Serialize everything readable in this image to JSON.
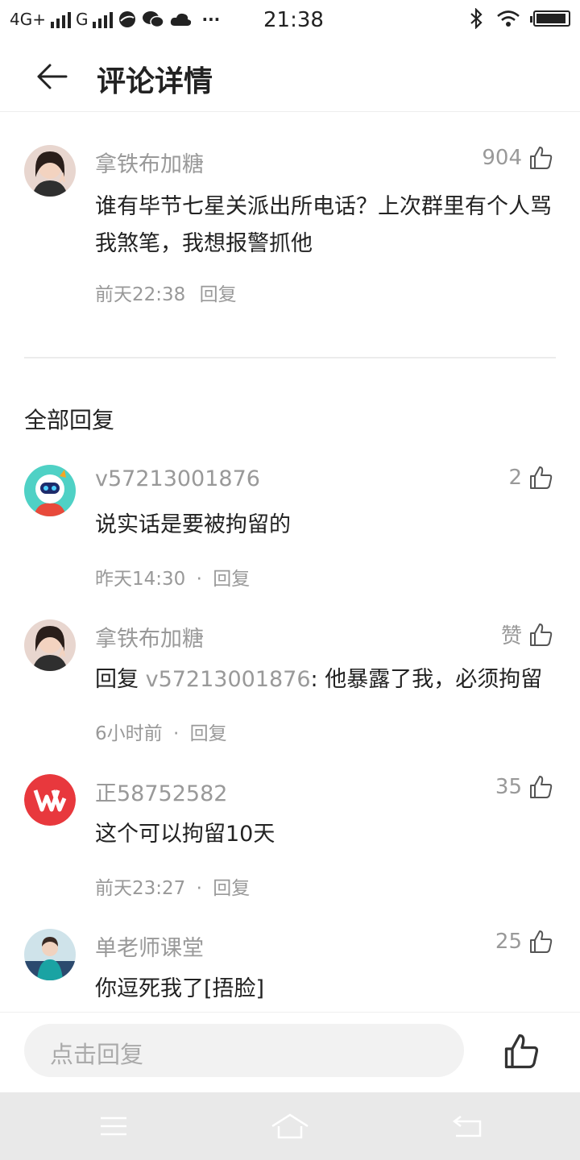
{
  "status_bar": {
    "network1": "4G+",
    "network2": "G",
    "time": "21:38",
    "more": "···"
  },
  "header": {
    "title": "评论详情"
  },
  "main_comment": {
    "username": "拿铁布加糖",
    "likes": "904",
    "text": "谁有毕节七星关派出所电话？上次群里有个人骂我煞笔，我想报警抓他",
    "time": "前天22:38",
    "reply_label": "回复"
  },
  "section_title": "全部回复",
  "replies": [
    {
      "username": "v57213001876",
      "likes": "2",
      "text": "说实话是要被拘留的",
      "time": "昨天14:30",
      "sep": "·",
      "reply_label": "回复"
    },
    {
      "username": "拿铁布加糖",
      "likes": "赞",
      "text_prefix": "回复 ",
      "text_target": "v57213001876",
      "text": ": 他暴露了我，必须拘留",
      "time": "6小时前",
      "sep": "·",
      "reply_label": "回复"
    },
    {
      "username": "正58752582",
      "likes": "35",
      "text": "这个可以拘留10天",
      "time": "前天23:27",
      "sep": "·",
      "reply_label": "回复"
    },
    {
      "username": "单老师课堂",
      "likes": "25",
      "text": "你逗死我了[捂脸]"
    }
  ],
  "bottom_bar": {
    "placeholder": "点击回复"
  },
  "colors": {
    "accent_text": "#222222",
    "muted_text": "#999999",
    "wps_red": "#e8383d"
  }
}
